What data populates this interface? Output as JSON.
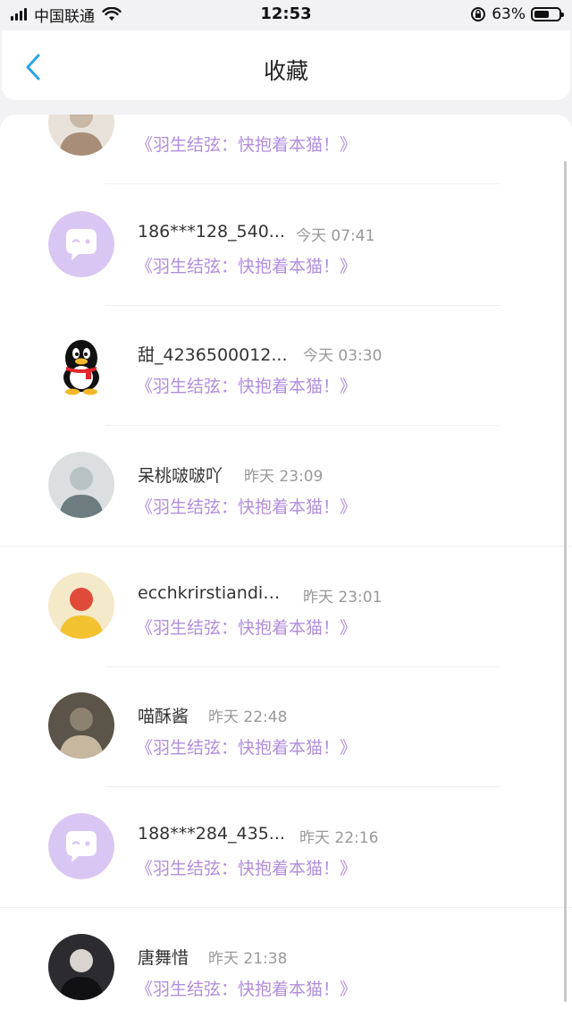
{
  "status_bar": {
    "carrier": "中国联通",
    "time": "12:53",
    "battery": "63%",
    "battery_level": 0.63
  },
  "nav": {
    "title": "收藏",
    "back_icon": "chevron-left-icon"
  },
  "colors": {
    "accent": "#2aa4e6",
    "work_title": "#b08fdc",
    "avatar_placeholder": "#d9c7f3"
  },
  "items": [
    {
      "name": "",
      "time": "",
      "work": "《羽生结弦：快抱着本猫！》",
      "avatar": "photo"
    },
    {
      "name": "186***128_540...",
      "time": "今天 07:41",
      "work": "《羽生结弦：快抱着本猫！》",
      "avatar": "default-chat"
    },
    {
      "name": "甜_4236500012...",
      "time": "今天 03:30",
      "work": "《羽生结弦：快抱着本猫！》",
      "avatar": "qq-penguin"
    },
    {
      "name": "呆桃啵啵吖",
      "time": "昨天 23:09",
      "work": "《羽生结弦：快抱着本猫！》",
      "avatar": "photo"
    },
    {
      "name": "ecchkrirstiandioxr",
      "time": "昨天 23:01",
      "work": "《羽生结弦：快抱着本猫！》",
      "avatar": "photo"
    },
    {
      "name": "喵酥酱",
      "time": "昨天 22:48",
      "work": "《羽生结弦：快抱着本猫！》",
      "avatar": "photo"
    },
    {
      "name": "188***284_435...",
      "time": "昨天 22:16",
      "work": "《羽生结弦：快抱着本猫！》",
      "avatar": "default-chat"
    },
    {
      "name": "唐舞惜",
      "time": "昨天 21:38",
      "work": "《羽生结弦：快抱着本猫！》",
      "avatar": "photo"
    }
  ]
}
